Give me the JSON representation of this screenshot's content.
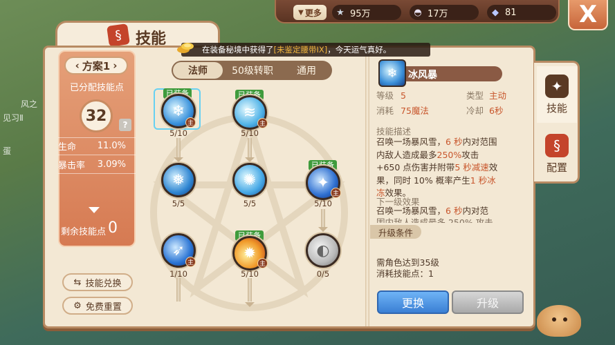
{
  "topbar": {
    "more_label": "更多",
    "stars": "95万",
    "shells": "17万",
    "gems": "81",
    "close_label": "X"
  },
  "window": {
    "title": "技能"
  },
  "notice": {
    "prefix": "在装备秘境中获得了",
    "item": "[未鉴定腰带IX]",
    "suffix": "，今天运气真好。"
  },
  "left_panel": {
    "plan_label": "方案1",
    "allocated_label": "已分配技能点",
    "allocated_points": "32",
    "help": "?",
    "stats": [
      {
        "label": "生命",
        "value": "11.0%"
      },
      {
        "label": "暴击率",
        "value": "3.09%"
      }
    ],
    "remaining_label": "剩余技能点",
    "remaining_points": "0",
    "exchange_label": "技能兑换",
    "reset_label": "免费重置"
  },
  "tabs": [
    {
      "label": "法师",
      "active": true
    },
    {
      "label": "50级转职",
      "active": false
    },
    {
      "label": "通用",
      "active": false
    }
  ],
  "skills": [
    {
      "id": "ice-storm",
      "level": "5/10",
      "equipped": "已装备",
      "main": "主"
    },
    {
      "id": "frost-wave",
      "level": "5/10",
      "equipped": "已装备",
      "main": "主"
    },
    {
      "id": "snowflake",
      "level": "5/5"
    },
    {
      "id": "ice-burst",
      "level": "5/5"
    },
    {
      "id": "frost-spirit",
      "level": "5/10",
      "equipped": "已装备",
      "main": "主"
    },
    {
      "id": "arcane-bolt",
      "level": "1/10",
      "main": "主"
    },
    {
      "id": "flame-burst",
      "level": "5/10",
      "equipped": "已装备",
      "main": "主"
    },
    {
      "id": "stone-shield",
      "level": "0/5"
    }
  ],
  "detail": {
    "name": "冰风暴",
    "level_label": "等级",
    "level_value": "5",
    "type_label": "类型",
    "type_value": "主动",
    "cost_label": "消耗",
    "cost_value": "75魔法",
    "cooldown_label": "冷却",
    "cooldown_value": "6秒",
    "desc_title": "技能描述",
    "desc": [
      {
        "t": "召唤一场暴风雪，",
        "r": "6 秒"
      },
      {
        "t": "内对范围内敌人造成最多",
        "r": "250%"
      },
      {
        "t": "攻击+650 点伤害并附带",
        "r": "5 秒减速"
      },
      {
        "t": "效果，同时 10% 概率产生",
        "r": "1 秒冰冻"
      },
      {
        "t": "效果。",
        "r": ""
      }
    ],
    "next_title": "下一级效果",
    "next_line1_a": "召唤一场暴风雪，",
    "next_line1_r": "6 秒",
    "next_line1_b": "内对范",
    "next_line2": "围内敌人造成最多 250% 攻击",
    "upgrade_tag": "升级条件",
    "req_level": "需角色达到35级",
    "req_points": "消耗技能点：1",
    "swap_label": "更换",
    "upgrade_label": "升级"
  },
  "side_tabs": [
    {
      "label": "技能",
      "active": true
    },
    {
      "label": "配置",
      "active": false
    }
  ],
  "background_text": {
    "a": "风之",
    "b": "见习Ⅱ",
    "c": "蛋"
  }
}
